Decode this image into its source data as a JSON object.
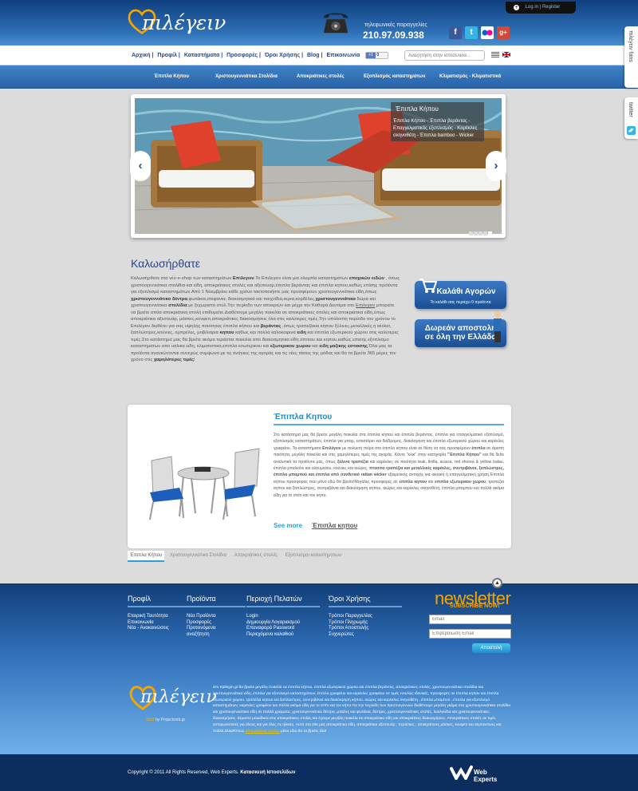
{
  "header": {
    "logo_text": "πιλέγειν",
    "phone_label": "τηλεφωνικές παραγγελίες",
    "phone_number": "210.97.09.938",
    "login_label": "Log in",
    "register_label": "Register",
    "social": [
      "f",
      "t",
      "flickr",
      "g+"
    ]
  },
  "topnav": {
    "items": [
      "Αρχική",
      "Προφίλ",
      "Καταστήματα",
      "Προσφορές",
      "Όροι Χρήσης",
      "Blog",
      "Επικοινωνία"
    ],
    "fb_count": "0",
    "fb_like": "+1",
    "search_placeholder": "Αναζήτηση στην ιστοσελίδα...",
    "languages": [
      "el",
      "en"
    ]
  },
  "catnav": {
    "items": [
      "Έπιπλα Κήπου",
      "Χριστουγεννιάτικα Στολίδια",
      "Αποκριάτικες στολές",
      "Εξοπλισμός καταστημάτων",
      "Κλιματισμός - Κλιματιστικά"
    ]
  },
  "slider": {
    "caption_title": "Έπιπλα Κήπου",
    "caption_text": "Έπιπλα Κήπου - Έπιπλα βεράντας - Επαγγελματικός εξοπλισμός - Καρέκλες σκηνοθέτη - Έπιπλα bamboo - Wicker",
    "slide_count": 5,
    "active_slide": 5
  },
  "welcome": {
    "title": "Καλωσήρθατε",
    "text_p1": "Καλωσήρθατε στο νέο e-shop των καταστημάτων ",
    "brand": "Επιλεγειν",
    "text_p2": ".Το Επιλεγειν είναι μια ολυμπία καταστημάτων ",
    "b1": "εποχικών ειδών",
    "text_p3": " , όπως χριστουγεννιάτικα στολίδια και είδη, αποκριάτικες στολές και αξεσουαρ,έπιπλα βεράντας και έπιπλα κηπου,καθώς επίσης προϊόντα για εξοπλισμό καταστημάτων.Από 1 Νοεμβρίου κάθε χρόνο τακτοποιήστε μας προσφέρουν χριστουγεννιάτικα είδη,όπως ",
    "b2": "χριστουγεννιάτικο δέντρα",
    "text_p4": ",φωτάκια,στεφανια, διακοσμητικά και παιχνίδια,κερια,κορδέλες,",
    "b3": "χριστουγεννιάτικα",
    "text_p5": " δώρα και χριστουγεννιάτικα ",
    "b4": "στολίδια",
    "text_p6": " με ξεχωριστό στύλ.Την περίοδο των αποκριών και μέχρι την Καθαρά Δευτέρα στο ",
    "link1": "Επιλεγειν",
    "text_p7": " μπορείτε να βρείτε απόα αποκριάτικη στολή επιθυμείτε.Διαθέτουμε μεγάλη ποικιλία σε αποκριάτικες στολές και αποκριάτικα είδη,όπως αποκριάτικα αξεσουάρ, μάσκες,κονφετι,αποκριάτικες διακοσμήσεις όλα στις καλύτερες τιμές.Την υπόλοιπη περίοδο του χρόνου το Επιλέγειν διαθέτει για σας υψηλής ποιότητας έπιπλα κήπου και ",
    "b5": "βεράντας",
    "text_p8": " ,όπως τραπεζάκια κήπου ξύλινες,μεταλλικές ή wicker, ξαπλώστρες,κούνιες, ομπρέλες, μοβιλιαρια ",
    "b6": "κηπου",
    "text_p9": " καθως και πολλά καλοκαιρινα ",
    "b7": "ειδη",
    "text_p10": " και έπιπλα εξωτερικού χώρου στις καλύτερες τιμές.Στο κατάστημα μας θα βρείτε ακόμα τεράστια ποικιλια απο διακοσμητικα είδη σπιτιου και κηπου,καθώς επισης εξοπλισμο καταστηματων απο υαλικα ειδη, κλιματιστικα,επιπλα εσωτερικου και ",
    "b8": "εξωτερικου χωρου",
    "text_p11": " και ",
    "b9": "ειδη μαζικης εστιασης",
    "text_p12": ".Όλα μας τα προϊόντα ανανεώνονται συνεχώς συμφωνα με τις ανάγκες της αγοράς και τις νέες τάσεις της μόδας και θα τα βρείτε 365 μέρες τον χρόνο στις ",
    "b10": "χαμηλότερες τιμές",
    "text_p13": "!"
  },
  "promos": {
    "cart_title": "Καλάθι Αγορών",
    "cart_sub": "Το καλάθι σας περιέχει 0 προϊόντα",
    "shipping_line1": "Δωρεάν αποστολή",
    "shipping_line2": "σε όλη την Ελλάδα"
  },
  "featured": {
    "title": "Έπιπλα Κηπου",
    "text_p1": "Στο κατάστημα μας θα βρείτε μεγάλη ποικιλία στα έπιπλα κήπου και έπιπλα βεράντας, έπιπλα για επαγγελματικό εξοπλισμό, εξοπλισμός καταστημάτων, έπιπλα για μπαρ, εστιατόριο και διάδρομος, διακόσμηση και έπιπλα εξωτερικού χώρου και καρέκλες γραφείου. Τα καταστήματα ",
    "brand": "Επιλέγειν",
    "text_p2": " με πολυετή πείρα στο έπιπλο κήπου είναι σε θέση να σας προσφέρουν ",
    "b1": "έπιπλα",
    "text_p3": " σε άριστη ποιότητα, μεγάλη ποικιλία και στις χαμηλότερες τιμές της αγοράς. Κάντε \"κλικ\" στην κατηγορία ",
    "b2": "\"Έπιπλα Κήπου\"",
    "text_p4": " και θα δείτε αναλυτικά τα προϊόντα μας, όπως ",
    "b3": "ξύλινα τραπέζια",
    "text_p5": " και καρέκλες σε ποιότητα teak, linilla, acacia, red shorea & yellow balau, έπιπλα μπαλκόνι και αλουμινίου, κούνιες και αιώρες, ",
    "b4": "πτυσσα τραπέζια και μεταλλικές καρέκλες, συντριβάνια, ξαπλώστρες, έπιπλα μπαμπού και έπιπλα από συνθετικό rattan wicker",
    "text_p6": " εξαιρετικής αντοχής για οικιακή ή επαγγελματική χρήση.Έπιπλα κήπου προσφορας που μόνο εδώ θα βρείτε!Μεγάλες προσφορές σε ",
    "b5": "επιπλα κηπου",
    "text_p7": " και ",
    "b6": "επιπλα εξωτερικου χωρου",
    "text_p8": ", τραπεζια κηπου και ξαπλώστρες, συντριβάνια και διακόσμηση κήπου, αιώρες και καρέκλες σκηνοθέτη, έπιπλα μπαμπου και πολλά ακόμα είδη για το σπίτι και τον κήπο.",
    "see_more": "See more",
    "category_link": "Έπιπλα κηπου"
  },
  "feature_tabs": [
    "Έπιπλα Κήπου",
    "Χριστουγεννιάτικα Στολίδια",
    "Αποκριάτικες στολές",
    "Εξοπλισμοι καταστηματων"
  ],
  "footer": {
    "col1_title": "Προφίλ",
    "col1_items": [
      "Εταιρική Ταυτότητα",
      "Επικοινωνία",
      "Νέα - Ανακοινώσεις"
    ],
    "col2_title": "Προϊόντα",
    "col2_items": [
      "Νέα Προϊόντα",
      "Προσφορές",
      "Προτεινόμενα",
      "αναζήτηση"
    ],
    "col3_title": "Περιοχή Πελατών",
    "col3_items": [
      "Login",
      "Δημιουργία Λογαριασμού",
      "Επαναφορά Password",
      "Περιεχόμενα καλαθιού"
    ],
    "col4_title": "Όροι Χρήσης",
    "col4_items": [
      "Τρόποι Παραγγελίας",
      "Τρόποι Πληρωμής",
      "Τρόποι Αποστολής",
      "Συχνερώτες"
    ],
    "newsletter_title": "newsletter",
    "newsletter_sub": "SUBSCRIBE NOW!",
    "email_placeholder": "Email",
    "email_confirm_placeholder": "Επιβεβαίωση Email",
    "submit_label": "Αποστολή",
    "logo_text": "πιλέγειν",
    "seo_prefix": "SEO",
    "seo_by": " by Projectweb.gr",
    "about_text": "Στο Epilegin.gr θα βρείτε μεγάλη ποικιλία σε έπιπλα κήπου, έπιπλα εξωτερικού χώρου και έπιπλα βεράντας, αποκριάτικες στολές, χριστουγεννιάτικα στολίδια και χριστουγεννιάτικα είδη, έπιπλα για εξοπλισμό καταστημάτων, έπιπλα γραφείου και καρέκλες γραφείου σε τιμές εντελώς ιδανικές, προσφορές σε έπιπλα κηπου και έπιπλα εξωτερικού χώρου, τραπέζια κηπου και ξαπλώστρες, συντριβάνια και διακόσμηση κήπου, αιώρες και καρέκλες σκηνοθέτη , έπιπλα μπαμπού , έπιπλα για εξοπλισμό καταστημάτων, καρέκλες γραφείου και πολλά ακόμα είδη για το σπίτι και τον κήπο.Για την περίοδο των Χριστουγέννων διαθέτουμε μεγάλη γκάμα στα χριστουγεννιάτικα στολίδια και χριστουγεννιάτικα είδη σε πολλά χρώματα, χριστουγεννιάτικα δέντρα ,μπάλες και φωτάκια, δέντρες, χριστουγεννιάτικες στολές, λουλούδια και χριστουγεννιάτικες διακοσμήσεις. Είμαστε μοναδικοί στις αποκριάτικες στολές και έχουμε μεγάλη ποικιλία σε αποκριάτικα είδη και αποκριάτικες διακοσμήσεις, Αποκριάτικες στολές σε τιμές ανταγωνιστικές για όλους και για όλες τις ηλικίες. Αυτό στο site μας αποκριάτικα είδη, αποκριάτικα αξεσουάρ , περούκες , αποκριάτικες μάσκες, κονφετι και σερπαντινες και πολλά άλλα!Όπως ",
    "about_link": "αποκριάτικες στολές",
    "about_end": " μόνο εδώ θα τα βρείτε όλα!",
    "copyright": "Copyright © 2011 All Rights Reserved, Web Experts. ",
    "copyright_bold": "Κατασκευή Ιστοσελίδων",
    "webexperts_logo": "Web Experts"
  },
  "side_tabs": {
    "fans": "πιλέγειν fans",
    "twitter": "twitter"
  },
  "colors": {
    "header_blue": "#1e5aa0",
    "accent_orange": "#f5a400",
    "link_blue": "#27468c",
    "cyan": "#2aa0d8"
  }
}
